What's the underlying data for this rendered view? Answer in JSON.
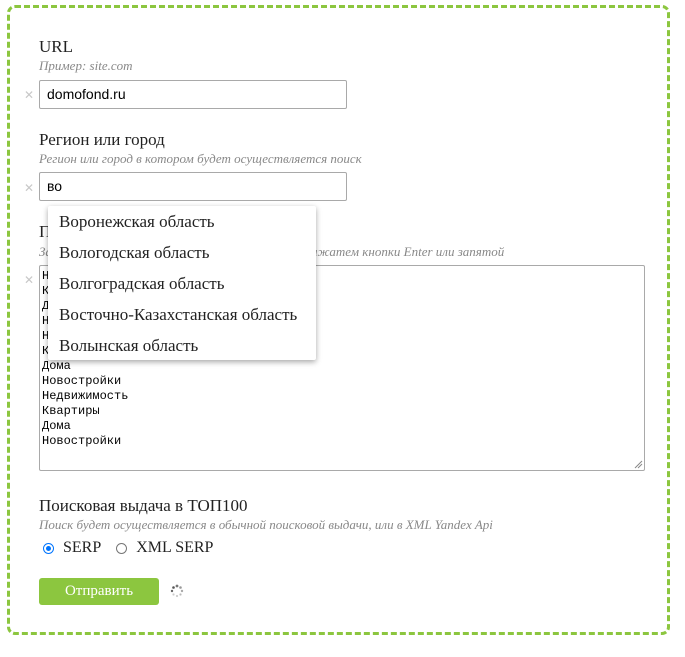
{
  "url": {
    "label": "URL",
    "hint": "Пример: site.com",
    "value": "domofond.ru",
    "clear_glyph": "✕"
  },
  "region": {
    "label": "Регион или город",
    "hint": "Регион или город в котором будет осуществляется поиск",
    "value": "во",
    "clear_glyph": "✕",
    "suggestions": [
      "Воронежская область",
      "Вологодская область",
      "Волгоградская область",
      "Восточно-Казахстанская область",
      "Волынская область"
    ]
  },
  "phrases": {
    "label_partial": "П",
    "hint_start": "За",
    "hint_end": "ажатем кнопки Enter или запятой",
    "clear_glyph": "✕",
    "hidden_line_initials": [
      "Н",
      "К",
      "Д",
      "Н",
      "Н",
      "К"
    ],
    "lines": [
      "Дома",
      "Новостройки",
      "Недвижимость",
      "Квартиры",
      "Дома",
      "Новостройки"
    ]
  },
  "serp": {
    "label": "Поисковая выдача в ТОП100",
    "hint": "Поиск будет осуществляется в обычной поисковой выдачи, или в XML Yandex Api",
    "options": [
      {
        "label": "SERP",
        "checked": true
      },
      {
        "label": "XML SERP",
        "checked": false
      }
    ]
  },
  "submit": {
    "label": "Отправить"
  },
  "colors": {
    "accent": "#8cc63f",
    "radio": "#0075ff"
  },
  "icons": {
    "loading": "loading-spinner-icon"
  }
}
